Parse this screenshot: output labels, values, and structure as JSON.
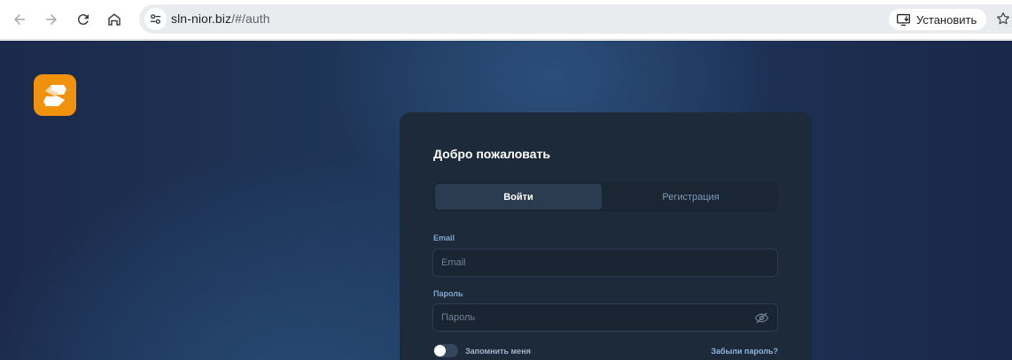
{
  "browser": {
    "url_host": "sln-nior.biz",
    "url_path": "/#/auth",
    "install_label": "Установить",
    "icons": [
      "back-arrow-icon",
      "forward-arrow-icon",
      "reload-icon",
      "home-icon",
      "site-settings-icon",
      "install-app-icon",
      "star-icon"
    ]
  },
  "page": {
    "logo_icon": "brand-s-logo",
    "brand_color": "#f0920e"
  },
  "auth": {
    "title": "Добро пожаловать",
    "tabs": [
      {
        "label": "Войти",
        "active": true
      },
      {
        "label": "Регистрация",
        "active": false
      }
    ],
    "email": {
      "label": "Email",
      "placeholder": "Email",
      "value": ""
    },
    "password": {
      "label": "Пароль",
      "placeholder": "Пароль",
      "value": ""
    },
    "remember_label": "Запомнить меня",
    "remember_on": false,
    "forgot_label": "Забыли пароль?"
  }
}
